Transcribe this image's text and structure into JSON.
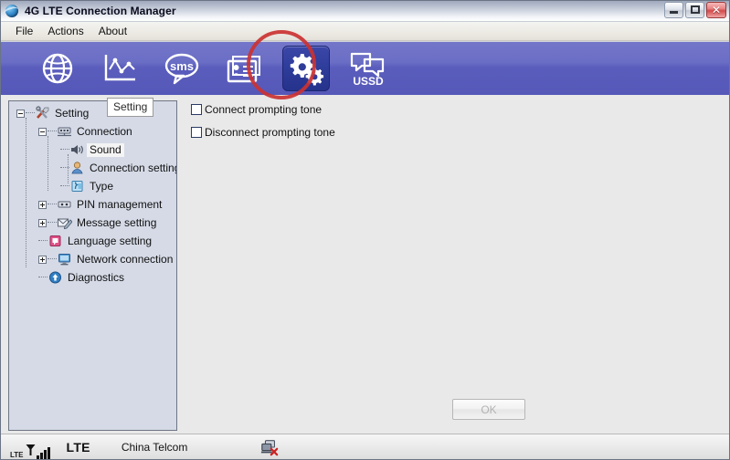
{
  "window": {
    "title": "4G LTE Connection Manager",
    "app_icon": "globe-icon",
    "controls": {
      "minimize": "minimize-button",
      "maximize": "maximize-button",
      "close_label": "✕"
    }
  },
  "menubar": {
    "items": [
      {
        "label": "File",
        "name": "menu-file"
      },
      {
        "label": "Actions",
        "name": "menu-actions"
      },
      {
        "label": "About",
        "name": "menu-about"
      }
    ]
  },
  "toolbar": {
    "buttons": [
      {
        "name": "toolbar-connection",
        "icon": "globe-icon",
        "label": "",
        "active": false
      },
      {
        "name": "toolbar-statistics",
        "icon": "chart-icon",
        "label": "",
        "active": false
      },
      {
        "name": "toolbar-sms",
        "icon": "sms-icon",
        "label": "sms",
        "active": false
      },
      {
        "name": "toolbar-phonebook",
        "icon": "contacts-icon",
        "label": "",
        "active": false
      },
      {
        "name": "toolbar-setting",
        "icon": "gears-icon",
        "label": "",
        "active": true
      },
      {
        "name": "toolbar-ussd",
        "icon": "ussd-icon",
        "label": "USSD",
        "active": false
      }
    ],
    "accent_color": "#5558b8",
    "active_color": "#2e3c9a"
  },
  "annotation": {
    "shape": "circle",
    "color": "#cb3232",
    "target": "toolbar-setting"
  },
  "tooltip": {
    "text": "Setting"
  },
  "tree": {
    "nodes": [
      {
        "label": "Setting",
        "icon": "tools-icon",
        "depth": 0,
        "toggle": "minus",
        "selected": false
      },
      {
        "label": "Connection",
        "icon": "device-icon",
        "depth": 1,
        "toggle": "minus",
        "selected": false
      },
      {
        "label": "Sound",
        "icon": "speaker-icon",
        "depth": 2,
        "toggle": "none",
        "selected": true
      },
      {
        "label": "Connection setting",
        "icon": "user-icon",
        "depth": 2,
        "toggle": "none",
        "selected": false
      },
      {
        "label": "Type",
        "icon": "type-icon",
        "depth": 2,
        "toggle": "none",
        "selected": false
      },
      {
        "label": "PIN management",
        "icon": "keypad-icon",
        "depth": 1,
        "toggle": "plus",
        "selected": false
      },
      {
        "label": "Message setting",
        "icon": "message-edit-icon",
        "depth": 1,
        "toggle": "plus",
        "selected": false
      },
      {
        "label": "Language setting",
        "icon": "language-icon",
        "depth": 1,
        "toggle": "none",
        "selected": false
      },
      {
        "label": "Network connection",
        "icon": "monitor-icon",
        "depth": 1,
        "toggle": "plus",
        "selected": false
      },
      {
        "label": "Diagnostics",
        "icon": "diagnostics-icon",
        "depth": 1,
        "toggle": "none",
        "selected": false
      }
    ]
  },
  "settings_panel": {
    "checkboxes": [
      {
        "label": "Connect prompting tone",
        "checked": false,
        "name": "connect-prompting-tone-checkbox"
      },
      {
        "label": "Disconnect prompting tone",
        "checked": false,
        "name": "disconnect-prompting-tone-checkbox"
      }
    ],
    "ok_label": "OK",
    "ok_enabled": false
  },
  "statusbar": {
    "signal_label": "LTE",
    "signal_bars": 4,
    "network_type": "LTE",
    "carrier": "China Telcom",
    "connection_state_icon": "network-disconnected-icon"
  }
}
